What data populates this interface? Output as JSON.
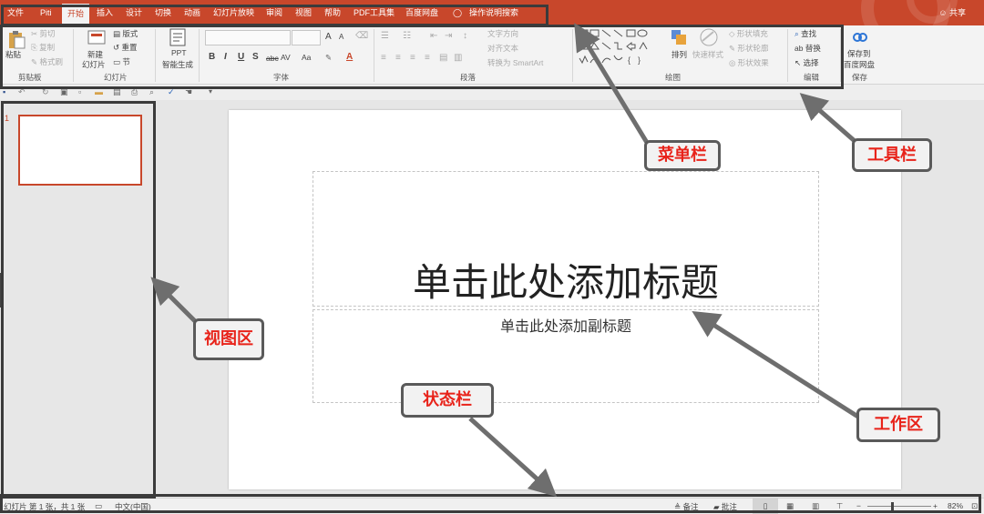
{
  "menu": {
    "items": [
      "文件",
      "Piti",
      "开始",
      "插入",
      "设计",
      "切换",
      "动画",
      "幻灯片放映",
      "审阅",
      "视图",
      "帮助",
      "PDF工具集",
      "百度网盘"
    ],
    "active": "开始",
    "search": "操作说明搜索",
    "share": "共享"
  },
  "ribbon": {
    "clipboard": {
      "label": "剪贴板",
      "paste": "粘贴",
      "cut": "剪切",
      "copy": "复制",
      "format_painter": "格式刷"
    },
    "slides": {
      "label": "幻灯片",
      "new_slide": "新建",
      "new_slide_2": "幻灯片",
      "layout": "版式",
      "reset": "重置",
      "section": "节"
    },
    "ppt": {
      "label1": "PPT",
      "label2": "智能生成"
    },
    "font": {
      "label": "字体",
      "bold": "B",
      "italic": "I",
      "underline": "U",
      "shadow": "S",
      "strike": "abc",
      "spacing": "AV",
      "case": "Aa",
      "grow": "A",
      "shrink": "A"
    },
    "paragraph": {
      "label": "段落",
      "text_direction": "文字方向",
      "align_text": "对齐文本",
      "smartart": "转换为 SmartArt"
    },
    "drawing": {
      "label": "绘图",
      "arrange": "排列",
      "quick_styles": "快速样式",
      "fill": "形状填充",
      "outline": "形状轮廓",
      "effects": "形状效果"
    },
    "editing": {
      "label": "编辑",
      "find": "查找",
      "replace": "替换",
      "select": "选择"
    },
    "save": {
      "label": "保存",
      "save_to": "保存到",
      "baidu": "百度网盘"
    }
  },
  "thumbnail": {
    "number": "1"
  },
  "slide": {
    "title": "单击此处添加标题",
    "subtitle": "单击此处添加副标题"
  },
  "statusbar": {
    "slide_info": "幻灯片 第 1 张，共 1 张",
    "language": "中文(中国)",
    "notes": "备注",
    "comments": "批注",
    "zoom": "82%"
  },
  "callouts": {
    "menubar": "菜单栏",
    "toolbar": "工具栏",
    "viewarea": "视图区",
    "statusbar": "状态栏",
    "workarea": "工作区"
  },
  "colors": {
    "accent": "#c8472b",
    "callout_text": "#e8231a"
  }
}
